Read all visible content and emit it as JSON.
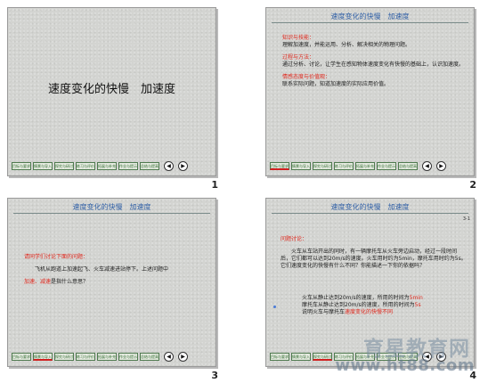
{
  "slides": [
    {
      "number": "1",
      "title": "速度变化的快慢　加速度",
      "nav": [
        "目标与要求",
        "情景与导入",
        "探究与研讨",
        "练习与评价",
        "拓展与补充",
        "作业与提示",
        "总结与提高"
      ]
    },
    {
      "number": "2",
      "header": "速度变化的快慢　加速度",
      "sections": [
        {
          "heading": "知识与技能：",
          "text": "理解加速度，并能运用、分析、解决相关的物理问题。"
        },
        {
          "heading": "过程与方法：",
          "text": "通过分析、讨论，让学生在感知物体速度变化有快慢的基础上，认识加速度。"
        },
        {
          "heading": "情感态度与价值观：",
          "text": "联系实际问题，知道加速度的实际应用价值。"
        }
      ],
      "nav": [
        "目标与要求",
        "情景与导入",
        "探究与研讨",
        "练习与评价",
        "拓展与补充",
        "作业与提示",
        "总结与提高"
      ]
    },
    {
      "number": "3",
      "header": "速度变化的快慢　加速度",
      "question": "请同学们讨论下面的问题：",
      "body": "飞机从跑道上加速起飞、火车减速进站停下。上述问题中",
      "red_part": "加速、减速",
      "tail": "是指什么意思？",
      "nav": [
        "目标与要求",
        "情景与导入",
        "探究与研讨",
        "练习与评价",
        "拓展与补充",
        "作业与提示",
        "总结与提高"
      ]
    },
    {
      "number": "4",
      "corner": "3-1",
      "heading": "问题讨论：",
      "para1": "火车从车站开出的同时，有一辆摩托车从火车旁边启动，经过一段时间后，它们都可以达到20m/s的速度。火车用时约为5min，摩托车用时约为5s。它们速度变化的快慢有什么不同？你能描述一下你的依据吗？",
      "line1a": "火车从静止达到20m/s的速度，所用的时间为",
      "line1b": "5min",
      "line2a": "摩托车从静止达到20m/s的速度，所用的时间为",
      "line2b": "5s",
      "line3a": "说明火车与摩托车",
      "line3b": "速度变化的快慢不同",
      "nav": [
        "目标与要求",
        "情景与导入",
        "探究与研讨",
        "练习与评价",
        "拓展与补充",
        "作业与提示",
        "总结与提高"
      ]
    }
  ],
  "watermark": {
    "text": "育星教育网",
    "url": "www.ht88.com"
  },
  "nav_icons": {
    "prev": "◀",
    "next": "▶"
  }
}
